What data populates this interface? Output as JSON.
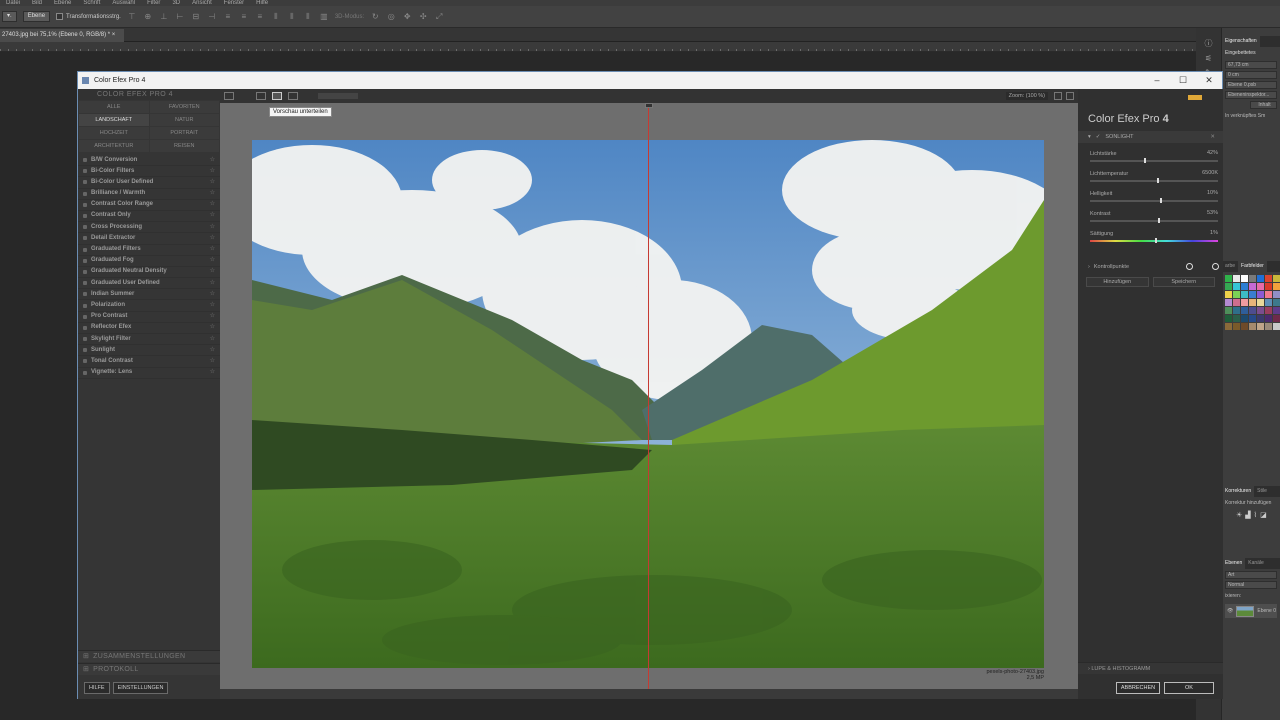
{
  "photoshop": {
    "menu": [
      "Datei",
      "Bild",
      "Ebene",
      "Schrift",
      "Auswahl",
      "Filter",
      "3D",
      "Ansicht",
      "Fenster",
      "Hilfe"
    ],
    "options": {
      "layer_select": "Ebene",
      "transform_label": "Transformationsstrg.",
      "mode3d_label": "3D-Modus:"
    },
    "doc_tab": "27403.jpg bei 75,1% (Ebene 0, RGB/8) * ×",
    "properties_tabs": [
      "Eigenschaften"
    ],
    "properties_title": "Eingebettetes",
    "fields": [
      "67,73 cm",
      "0 cm",
      "Ebene 0.psb",
      "Ebeneninspektor..."
    ],
    "props_button": "Inhalt",
    "link_text": "In verknüpftes Sm",
    "color_tabs": [
      "arbe",
      "Farbfelder"
    ],
    "adjust_tabs": [
      "Korrekturen",
      "Stile"
    ],
    "adjust_label": "Korrektur hinzufügen",
    "layer_tabs": [
      "Ebenen",
      "Kanäle"
    ],
    "layer_kind": "Art",
    "blend_mode": "Normal",
    "lock_label": "ixieren:",
    "layer_name": "Ebene 0",
    "swatches": [
      "#2fb24a",
      "#e9e9e9",
      "#ffffff",
      "#7a7a7a",
      "#1f6fd6",
      "#d9442f",
      "#c9b83a",
      "#34a853",
      "#35c4d6",
      "#2d7fd4",
      "#c76ad4",
      "#e86ca8",
      "#d93a2a",
      "#f2a23c",
      "#eed24a",
      "#7bd156",
      "#3dbdc4",
      "#3a7ed1",
      "#8a5ad4",
      "#f07a8c",
      "#8f8fc6",
      "#b48ad0",
      "#cf6e8e",
      "#f09ca0",
      "#e7b47a",
      "#e8d89a",
      "#5f8fb6",
      "#3d7a8c",
      "#4e8f5a",
      "#2f6e8a",
      "#2f5e9a",
      "#4d4d8f",
      "#7a4d8f",
      "#9a3e5e",
      "#5e3c8a",
      "#1f5e3a",
      "#2b5e4a",
      "#1d4a6e",
      "#264a8a",
      "#3a3a6e",
      "#4a2a6e",
      "#6e2a4a",
      "#8a6a3a",
      "#7a5a2a",
      "#6e4a2a",
      "#a58a6e",
      "#bfa58a",
      "#9a8a7a",
      "#c9c9c9"
    ]
  },
  "dialog": {
    "title": "Color Efex Pro 4",
    "left": {
      "brand": "COLOR EFEX PRO 4",
      "categories": [
        {
          "label": "ALLE",
          "active": false
        },
        {
          "label": "FAVORITEN",
          "active": false
        },
        {
          "label": "LANDSCHAFT",
          "active": true
        },
        {
          "label": "NATUR",
          "active": false
        },
        {
          "label": "HOCHZEIT",
          "active": false
        },
        {
          "label": "PORTRAIT",
          "active": false
        },
        {
          "label": "ARCHITEKTUR",
          "active": false
        },
        {
          "label": "REISEN",
          "active": false
        }
      ],
      "filters": [
        "B/W Conversion",
        "Bi-Color Filters",
        "Bi-Color User Defined",
        "Brilliance / Warmth",
        "Contrast Color Range",
        "Contrast Only",
        "Cross Processing",
        "Detail Extractor",
        "Graduated Filters",
        "Graduated Fog",
        "Graduated Neutral Density",
        "Graduated User Defined",
        "Indian Summer",
        "Polarization",
        "Pro Contrast",
        "Reflector Efex",
        "Skylight Filter",
        "Sunlight",
        "Tonal Contrast",
        "Vignette: Lens"
      ],
      "recipes_label": "ZUSAMMENSTELLUNGEN",
      "history_label": "PROTOKOLL",
      "help_button": "HILFE",
      "settings_button": "EINSTELLUNGEN"
    },
    "toolbar": {
      "zoom_label": "Zoom: (100 %)",
      "tooltip": "Vorschau unterteilen"
    },
    "file": {
      "name": "pexels-photo-27403.jpg",
      "size": "2,5 MP"
    },
    "right": {
      "logo_text": "Color Efex Pro",
      "logo_number": "4",
      "brand_mark": "nik",
      "section_title": "SONLIGHT",
      "section_display": "SONLIGHT",
      "sliders": [
        {
          "label": "Lichtstärke",
          "value": "42%",
          "fraction": 0.42
        },
        {
          "label": "Lichttemperatur",
          "value": "6500K",
          "fraction": 0.52
        },
        {
          "label": "Helligkeit",
          "value": "10%",
          "fraction": 0.55
        },
        {
          "label": "Kontrast",
          "value": "53%",
          "fraction": 0.53
        },
        {
          "label": "Sättigung",
          "value": "1%",
          "fraction": 0.51
        }
      ],
      "control_points": "Kontrollpunkte",
      "add_button": "Hinzufügen",
      "save_button": "Speichern",
      "loupe_label": "LUPE & HISTOGRAMM",
      "cancel_button": "ABBRECHEN",
      "ok_button": "OK"
    }
  }
}
